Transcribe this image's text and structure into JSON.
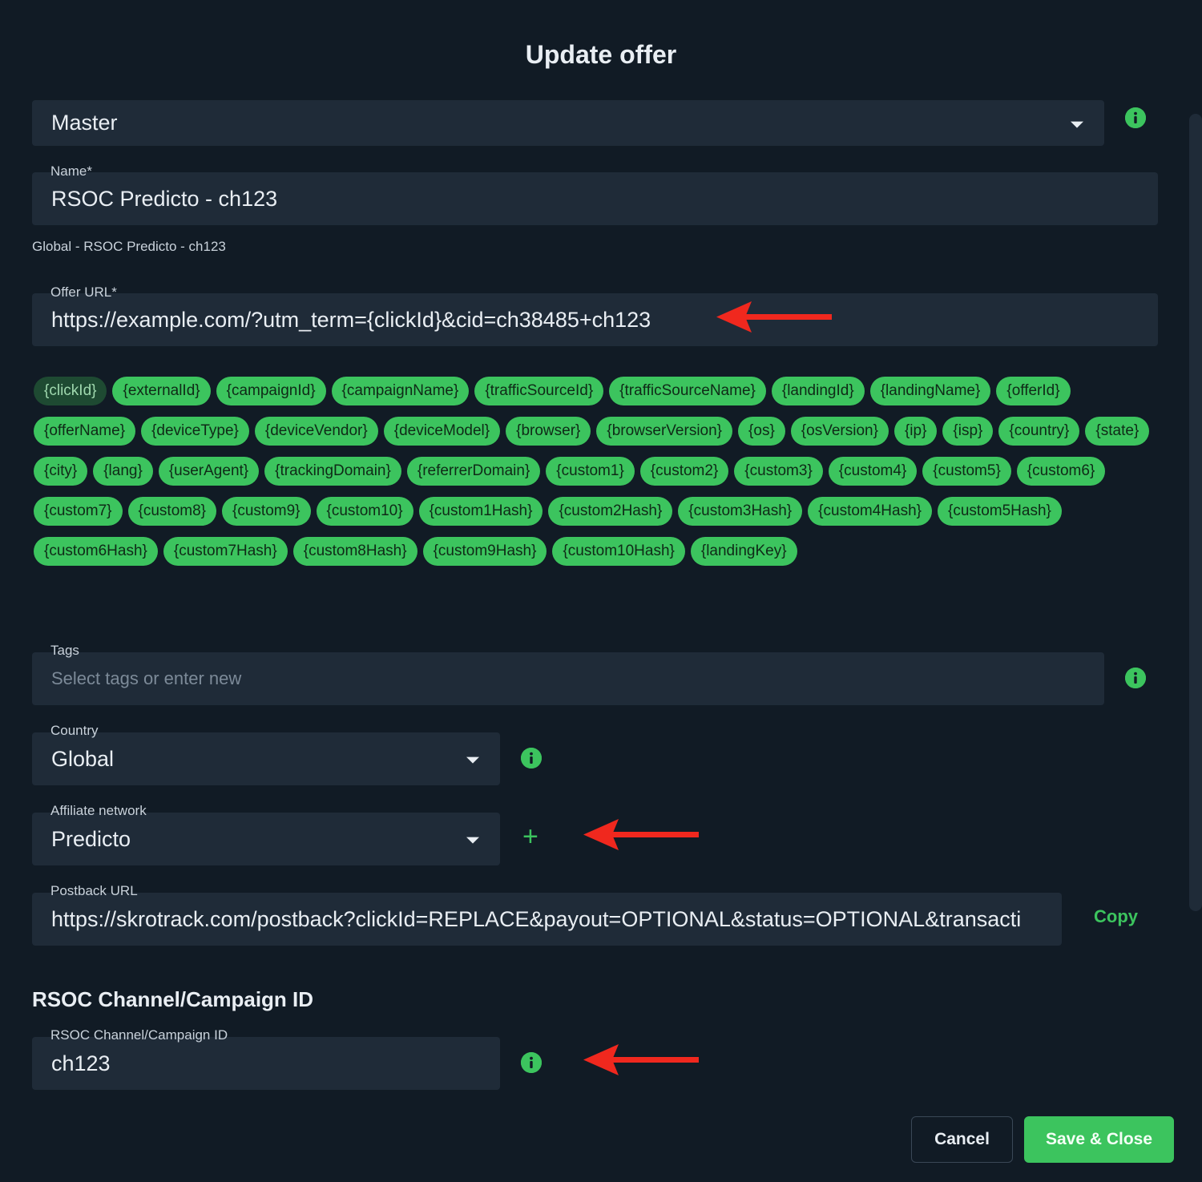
{
  "dialog": {
    "title": "Update offer"
  },
  "workspace": {
    "value": "Master"
  },
  "name": {
    "label": "Name*",
    "value": "RSOC Predicto - ch123",
    "hint": "Global - RSOC Predicto - ch123"
  },
  "offer_url": {
    "label": "Offer URL*",
    "value": "https://example.com/?utm_term={clickId}&cid=ch38485+ch123"
  },
  "tokens": [
    "{clickId}",
    "{externalId}",
    "{campaignId}",
    "{campaignName}",
    "{trafficSourceId}",
    "{trafficSourceName}",
    "{landingId}",
    "{landingName}",
    "{offerId}",
    "{offerName}",
    "{deviceType}",
    "{deviceVendor}",
    "{deviceModel}",
    "{browser}",
    "{browserVersion}",
    "{os}",
    "{osVersion}",
    "{ip}",
    "{isp}",
    "{country}",
    "{state}",
    "{city}",
    "{lang}",
    "{userAgent}",
    "{trackingDomain}",
    "{referrerDomain}",
    "{custom1}",
    "{custom2}",
    "{custom3}",
    "{custom4}",
    "{custom5}",
    "{custom6}",
    "{custom7}",
    "{custom8}",
    "{custom9}",
    "{custom10}",
    "{custom1Hash}",
    "{custom2Hash}",
    "{custom3Hash}",
    "{custom4Hash}",
    "{custom5Hash}",
    "{custom6Hash}",
    "{custom7Hash}",
    "{custom8Hash}",
    "{custom9Hash}",
    "{custom10Hash}",
    "{landingKey}"
  ],
  "tags": {
    "label": "Tags",
    "placeholder": "Select tags or enter new"
  },
  "country": {
    "label": "Country",
    "value": "Global"
  },
  "affiliate_network": {
    "label": "Affiliate network",
    "value": "Predicto",
    "add_symbol": "+"
  },
  "postback_url": {
    "label": "Postback URL",
    "value": "https://skrotrack.com/postback?clickId=REPLACE&payout=OPTIONAL&status=OPTIONAL&transacti",
    "copy_label": "Copy"
  },
  "rsoc": {
    "section_title": "RSOC Channel/Campaign ID",
    "label": "RSOC Channel/Campaign ID",
    "value": "ch123"
  },
  "footer": {
    "cancel_label": "Cancel",
    "save_label": "Save & Close"
  },
  "colors": {
    "background": "#111b25",
    "field": "#1f2b38",
    "accent": "#3cc45e",
    "annotation_arrow": "#f0281e"
  }
}
